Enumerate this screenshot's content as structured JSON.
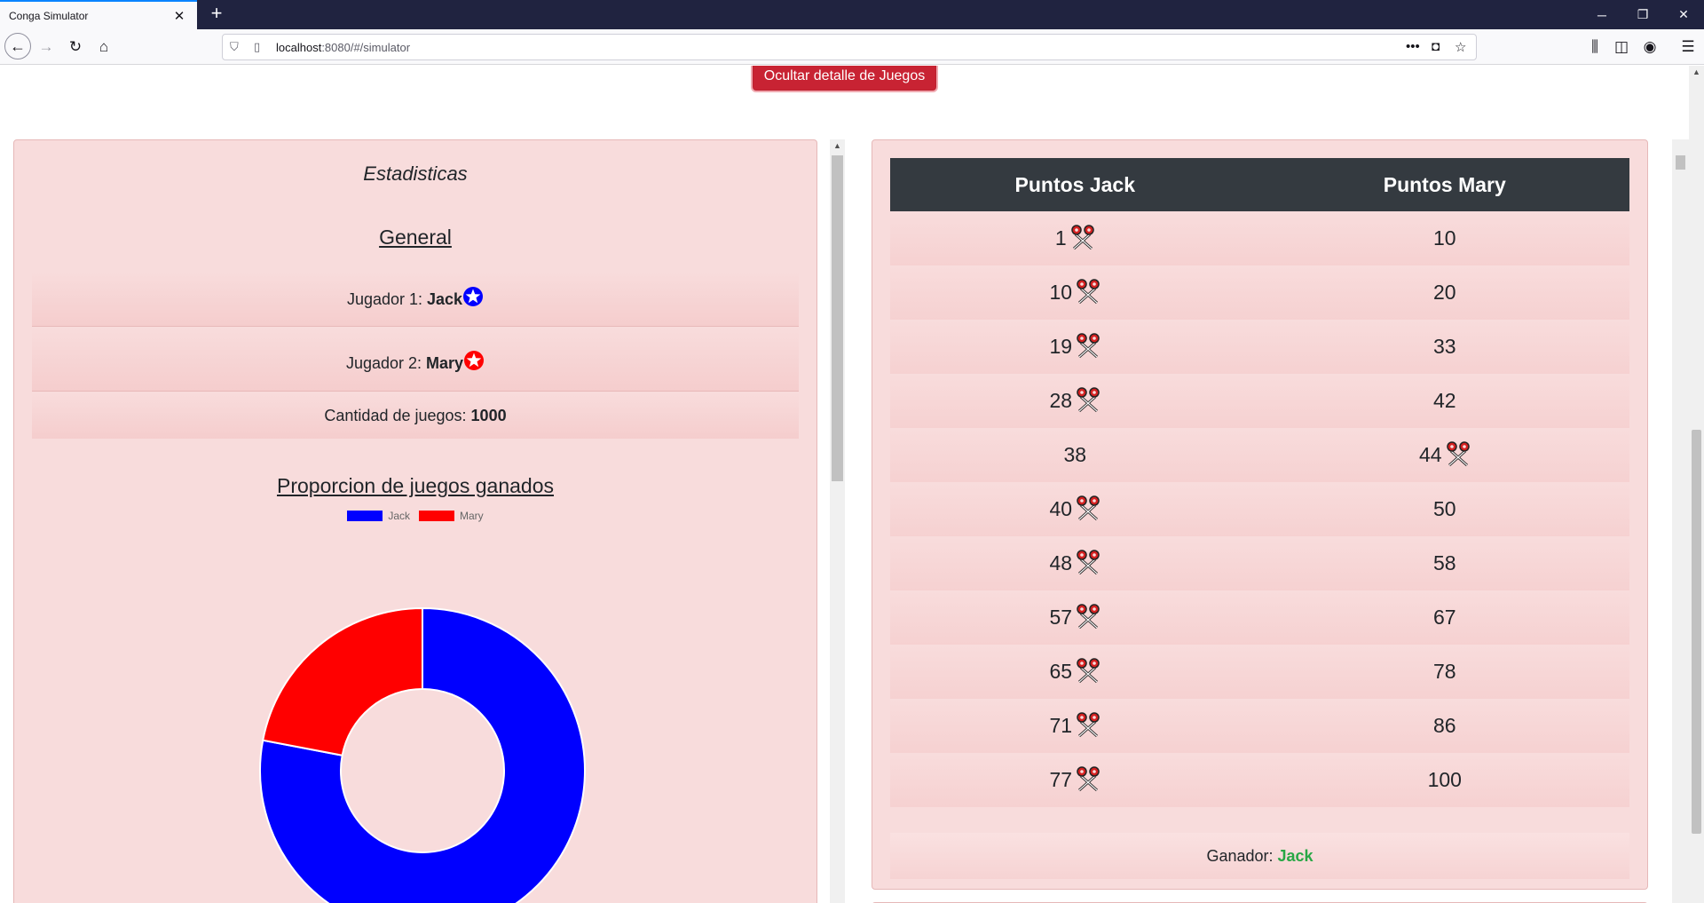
{
  "browser": {
    "tab_title": "Conga Simulator",
    "url_host": "localhost",
    "url_rest": ":8080/#/simulator"
  },
  "page": {
    "toggle_button": "Ocultar detalle de Juegos",
    "stats": {
      "title": "Estadisticas",
      "general_heading": "General",
      "player1_label": "Jugador 1:",
      "player1_name": "Jack",
      "player2_label": "Jugador 2:",
      "player2_name": "Mary",
      "games_label": "Cantidad de juegos:",
      "games_count": "1000",
      "chart_heading": "Proporcion de juegos ganados"
    },
    "points": {
      "headers": [
        "Puntos Jack",
        "Puntos Mary"
      ],
      "rows": [
        {
          "jack": "1",
          "mary": "10",
          "cut": "jack"
        },
        {
          "jack": "10",
          "mary": "20",
          "cut": "jack"
        },
        {
          "jack": "19",
          "mary": "33",
          "cut": "jack"
        },
        {
          "jack": "28",
          "mary": "42",
          "cut": "jack"
        },
        {
          "jack": "38",
          "mary": "44",
          "cut": "mary"
        },
        {
          "jack": "40",
          "mary": "50",
          "cut": "jack"
        },
        {
          "jack": "48",
          "mary": "58",
          "cut": "jack"
        },
        {
          "jack": "57",
          "mary": "67",
          "cut": "jack"
        },
        {
          "jack": "65",
          "mary": "78",
          "cut": "jack"
        },
        {
          "jack": "71",
          "mary": "86",
          "cut": "jack"
        },
        {
          "jack": "77",
          "mary": "100",
          "cut": "jack"
        }
      ],
      "winner_label": "Ganador:",
      "winner_name": "Jack"
    },
    "colors": {
      "jack": "#0000ff",
      "mary": "#ff0000",
      "winner": "#28a745",
      "button": "#c82333"
    }
  },
  "chart_data": {
    "type": "pie",
    "style": "doughnut",
    "labels": [
      "Jack",
      "Mary"
    ],
    "values": [
      78,
      22
    ],
    "colors": [
      "#0000ff",
      "#ff0000"
    ],
    "legend": "top"
  }
}
